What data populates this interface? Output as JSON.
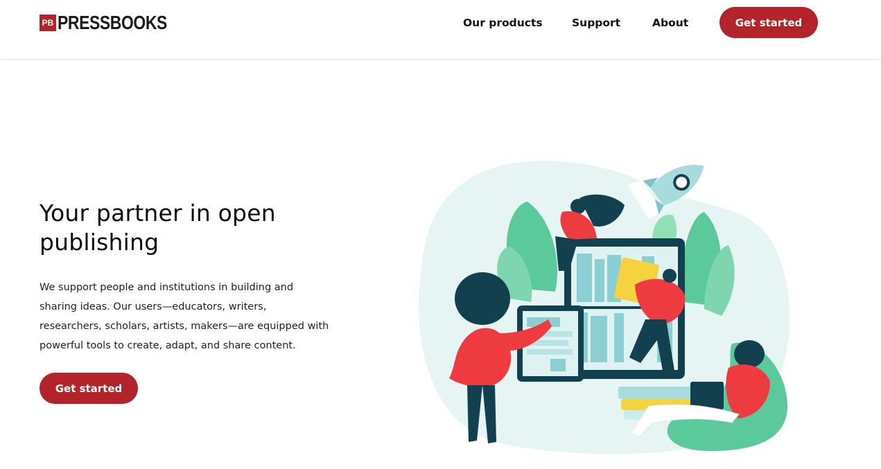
{
  "header": {
    "logo_badge": "PB",
    "logo_text": "PRESSBOOKS",
    "nav": {
      "products": "Our products",
      "support": "Support",
      "about": "About"
    },
    "cta": "Get started"
  },
  "hero": {
    "title": "Your partner in open publishing",
    "body": "We support people and institutions in building and sharing ideas. Our users—educators, writers, researchers, scholars, artists, makers—are equipped with powerful tools to create, adapt, and share content.",
    "cta": "Get started"
  },
  "colors": {
    "brand_red": "#b3232a",
    "teal_dark": "#12404f",
    "mint": "#5cc99a",
    "blob": "#e6f5f4"
  },
  "illustration": {
    "icon": "publishing-illustration"
  }
}
